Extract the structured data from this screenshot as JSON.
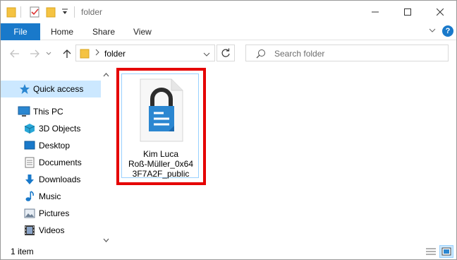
{
  "window": {
    "title": "folder"
  },
  "ribbon": {
    "tabs": [
      "File",
      "Home",
      "Share",
      "View"
    ],
    "help_label": "?"
  },
  "address": {
    "path": "folder",
    "search_placeholder": "Search folder"
  },
  "nav": {
    "quick_access": "Quick access",
    "this_pc": "This PC",
    "items": [
      "3D Objects",
      "Desktop",
      "Documents",
      "Downloads",
      "Music",
      "Pictures",
      "Videos"
    ]
  },
  "content": {
    "file_name": "Kim Luca Roß-Müller_0x643F7A2F_public",
    "file_name_lines": [
      "Kim Luca",
      "Roß-Müller_0x64",
      "3F7A2F_public"
    ]
  },
  "status": {
    "item_count": "1 item"
  },
  "colors": {
    "accent": "#1979ca",
    "selection": "#cce8ff",
    "highlight": "#e50000",
    "folder": "#f5c342",
    "lock_file": "#2b87d1"
  }
}
